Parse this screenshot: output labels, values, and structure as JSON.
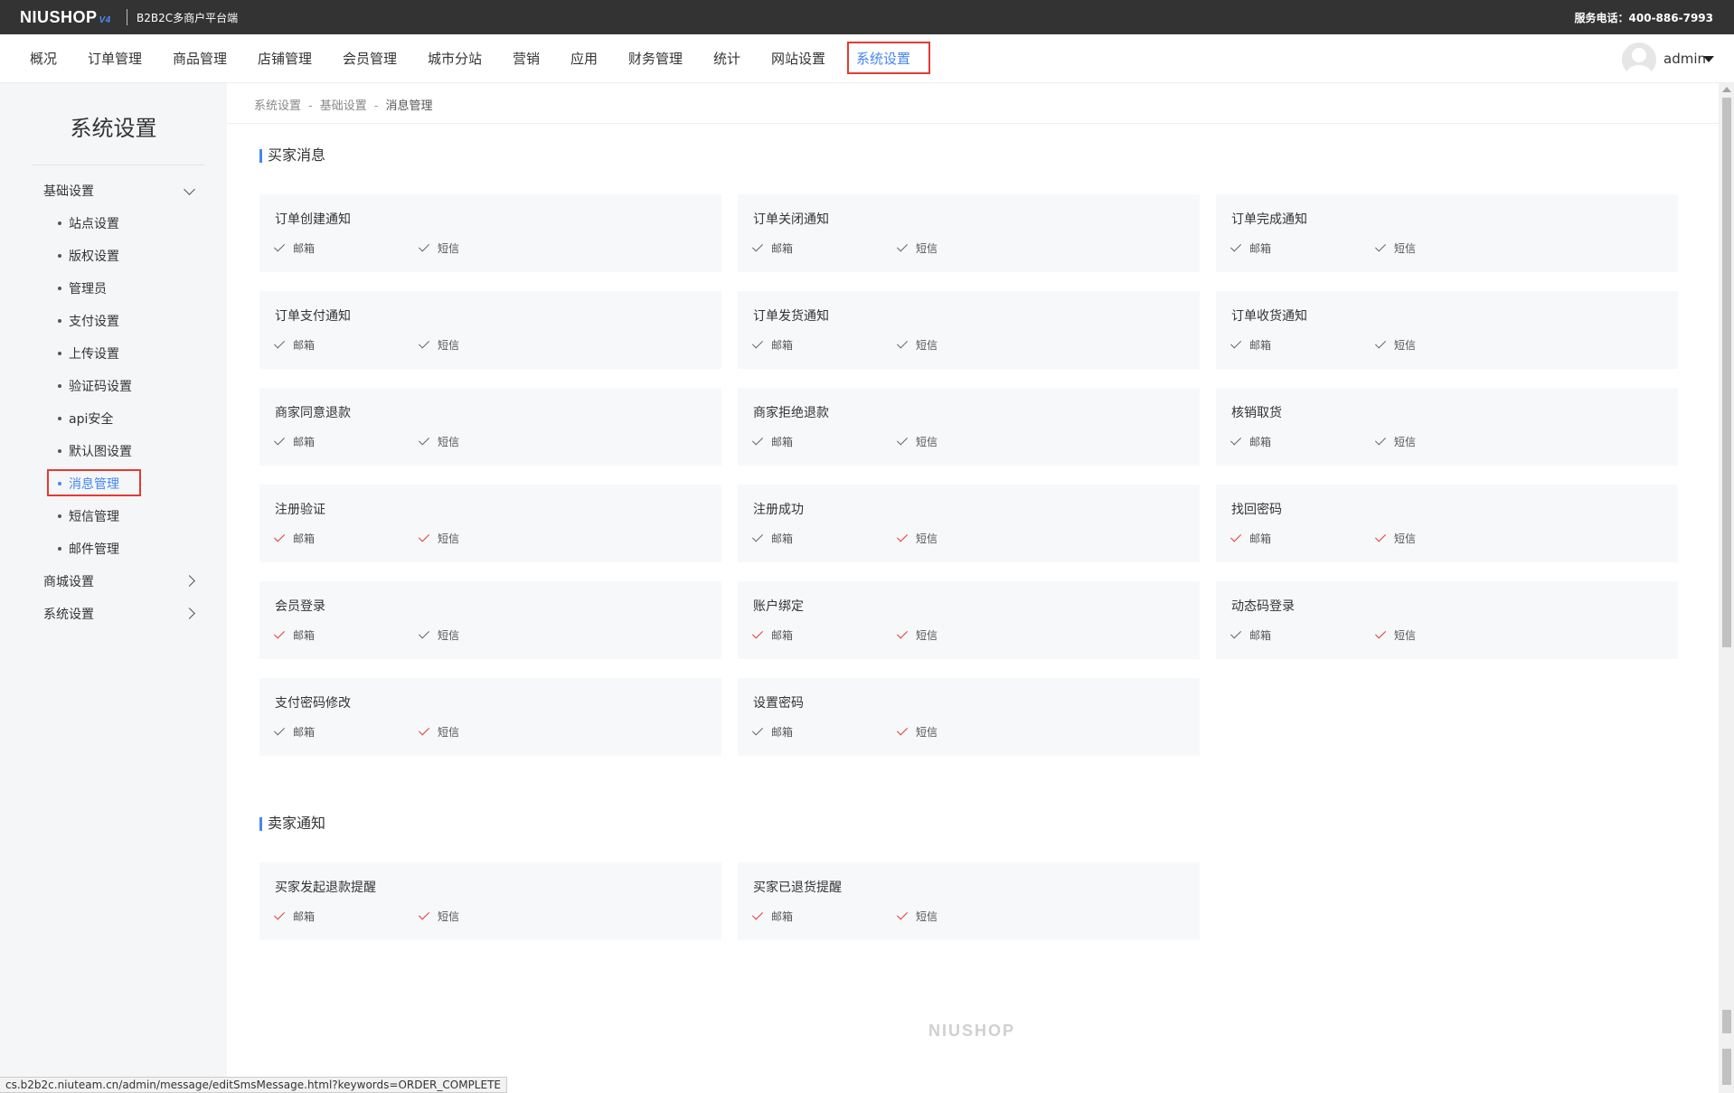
{
  "topbar": {
    "logo": "NIUSHOP",
    "logo_version": "V4",
    "subtitle": "B2B2C多商户平台端",
    "hotline": "服务电话：400-886-7993"
  },
  "nav": {
    "items": [
      "概况",
      "订单管理",
      "商品管理",
      "店铺管理",
      "会员管理",
      "城市分站",
      "营销",
      "应用",
      "财务管理",
      "统计",
      "网站设置",
      "系统设置"
    ],
    "active": "系统设置",
    "user": "admin"
  },
  "sidebar": {
    "title": "系统设置",
    "groups": [
      {
        "label": "基础设置",
        "expanded": true
      },
      {
        "label": "商城设置",
        "expanded": false
      },
      {
        "label": "系统设置",
        "expanded": false
      }
    ],
    "sub_items": [
      "站点设置",
      "版权设置",
      "管理员",
      "支付设置",
      "上传设置",
      "验证码设置",
      "api安全",
      "默认图设置",
      "消息管理",
      "短信管理",
      "邮件管理"
    ],
    "active_sub": "消息管理"
  },
  "breadcrumb": [
    "系统设置",
    "基础设置",
    "消息管理"
  ],
  "labels": {
    "email": "邮箱",
    "sms": "短信"
  },
  "status_colors": {
    "enabled": "#e53935",
    "disabled": "#666666"
  },
  "buyer_section": {
    "title": "买家消息",
    "cards": [
      {
        "title": "订单创建通知",
        "email_enabled": false,
        "sms_enabled": false
      },
      {
        "title": "订单关闭通知",
        "email_enabled": false,
        "sms_enabled": false
      },
      {
        "title": "订单完成通知",
        "email_enabled": false,
        "sms_enabled": false
      },
      {
        "title": "订单支付通知",
        "email_enabled": false,
        "sms_enabled": false
      },
      {
        "title": "订单发货通知",
        "email_enabled": false,
        "sms_enabled": false
      },
      {
        "title": "订单收货通知",
        "email_enabled": false,
        "sms_enabled": false
      },
      {
        "title": "商家同意退款",
        "email_enabled": false,
        "sms_enabled": false
      },
      {
        "title": "商家拒绝退款",
        "email_enabled": false,
        "sms_enabled": false
      },
      {
        "title": "核销取货",
        "email_enabled": false,
        "sms_enabled": false
      },
      {
        "title": "注册验证",
        "email_enabled": true,
        "sms_enabled": true
      },
      {
        "title": "注册成功",
        "email_enabled": false,
        "sms_enabled": true
      },
      {
        "title": "找回密码",
        "email_enabled": true,
        "sms_enabled": true
      },
      {
        "title": "会员登录",
        "email_enabled": true,
        "sms_enabled": false
      },
      {
        "title": "账户绑定",
        "email_enabled": true,
        "sms_enabled": true
      },
      {
        "title": "动态码登录",
        "email_enabled": false,
        "sms_enabled": true
      },
      {
        "title": "支付密码修改",
        "email_enabled": false,
        "sms_enabled": true
      },
      {
        "title": "设置密码",
        "email_enabled": false,
        "sms_enabled": true
      }
    ]
  },
  "seller_section": {
    "title": "卖家通知",
    "cards": [
      {
        "title": "买家发起退款提醒",
        "email_enabled": true,
        "sms_enabled": true
      },
      {
        "title": "买家已退货提醒",
        "email_enabled": true,
        "sms_enabled": true
      }
    ]
  },
  "footer": {
    "logo": "NIUSHOP"
  },
  "statusbar": {
    "url": "cs.b2b2c.niuteam.cn/admin/message/editSmsMessage.html?keywords=ORDER_COMPLETE"
  }
}
